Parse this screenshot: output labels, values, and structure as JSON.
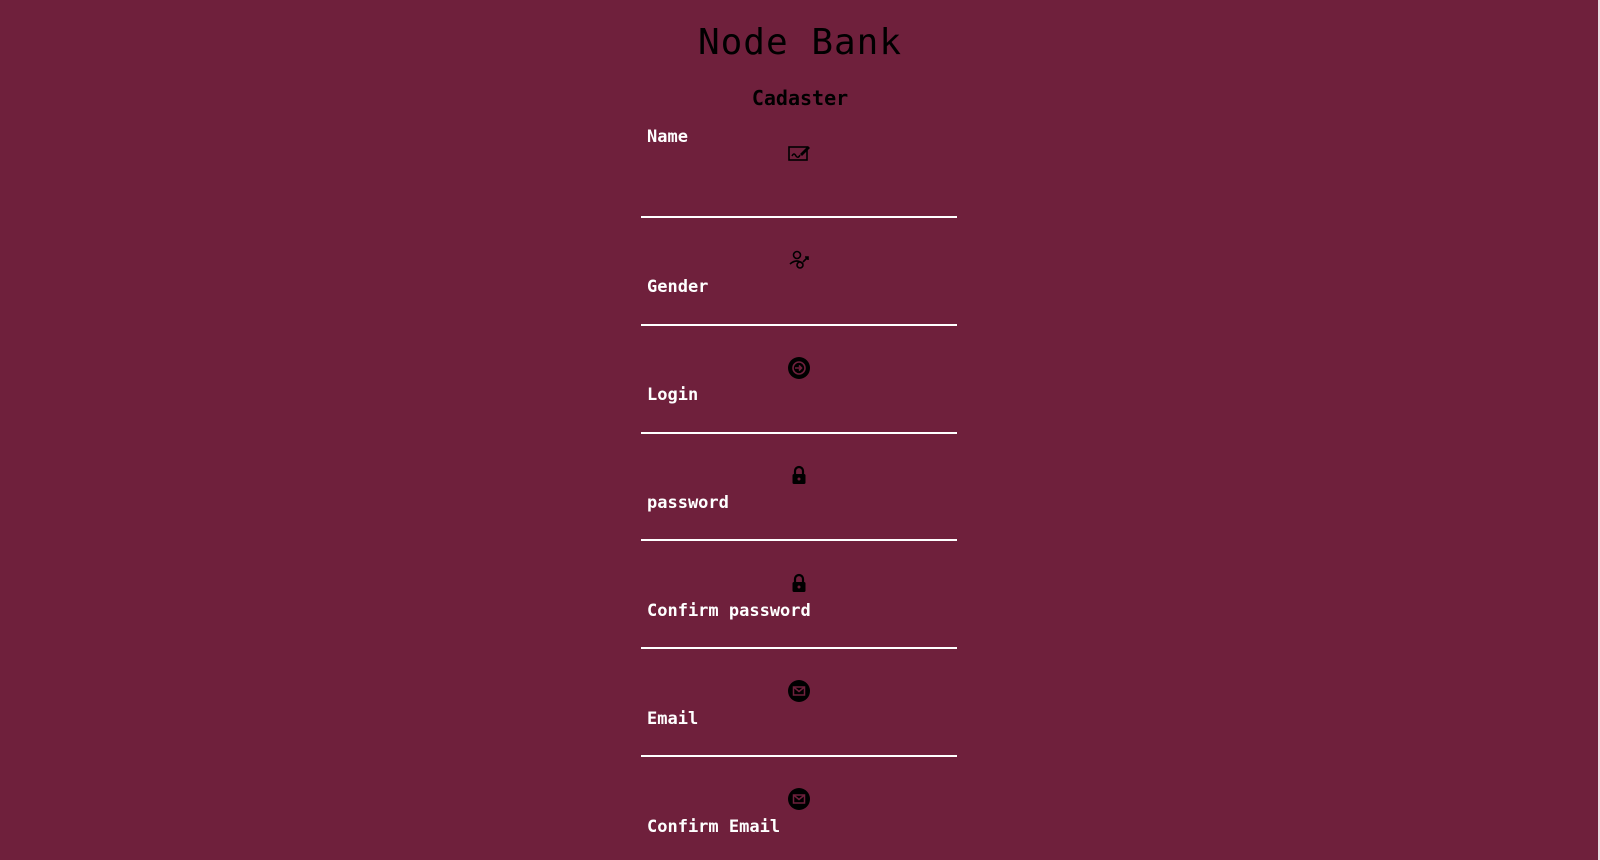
{
  "header": {
    "title": "Node Bank",
    "subtitle": "Cadaster"
  },
  "form": {
    "fields": [
      {
        "label": "Name",
        "icon": "signature-icon",
        "value": ""
      },
      {
        "label": "Gender",
        "icon": "gender-user-icon",
        "value": ""
      },
      {
        "label": "Login",
        "icon": "login-circle-icon",
        "value": ""
      },
      {
        "label": "password",
        "icon": "lock-icon",
        "value": ""
      },
      {
        "label": "Confirm password",
        "icon": "lock-icon",
        "value": ""
      },
      {
        "label": "Email",
        "icon": "email-circle-icon",
        "value": ""
      },
      {
        "label": "Confirm Email",
        "icon": "email-circle-icon",
        "value": ""
      }
    ]
  },
  "colors": {
    "background": "#6f203c",
    "label": "#ffffff",
    "icon": "#000000",
    "underline": "#ffffff"
  }
}
